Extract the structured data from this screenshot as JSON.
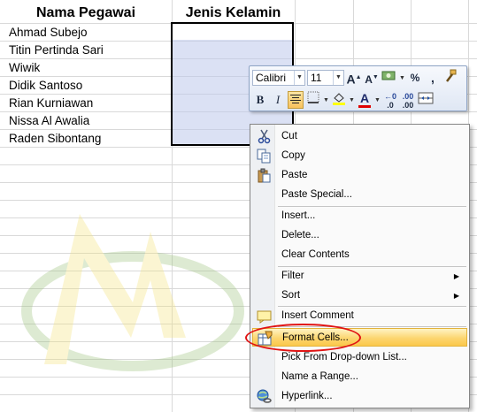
{
  "sheet": {
    "headers": {
      "col_a": "Nama Pegawai",
      "col_b": "Jenis Kelamin"
    },
    "names": [
      "Ahmad Subejo",
      "Titin Pertinda Sari",
      "Wiwik",
      "Didik Santoso",
      "Rian Kurniawan",
      "Nissa Al Awalia",
      "Raden Sibontang"
    ]
  },
  "mini_toolbar": {
    "font_name": "Calibri",
    "font_size": "11",
    "grow_font": "A",
    "shrink_font": "A",
    "percent": "%",
    "comma": ",",
    "bold": "B",
    "italic": "I",
    "font_color_letter": "A",
    "inc_decimal": ".0",
    "dec_decimal": ".00"
  },
  "context_menu": {
    "items": [
      {
        "label": "Cut",
        "icon": "scissors-icon"
      },
      {
        "label": "Copy",
        "icon": "copy-icon"
      },
      {
        "label": "Paste",
        "icon": "paste-icon"
      },
      {
        "label": "Paste Special...",
        "icon": ""
      },
      {
        "label": "Insert...",
        "icon": ""
      },
      {
        "label": "Delete...",
        "icon": ""
      },
      {
        "label": "Clear Contents",
        "icon": ""
      },
      {
        "label": "Filter",
        "icon": "",
        "submenu": true
      },
      {
        "label": "Sort",
        "icon": "",
        "submenu": true
      },
      {
        "label": "Insert Comment",
        "icon": "comment-icon"
      },
      {
        "label": "Format Cells...",
        "icon": "format-cells-icon",
        "highlighted": true
      },
      {
        "label": "Pick From Drop-down List...",
        "icon": ""
      },
      {
        "label": "Name a Range...",
        "icon": ""
      },
      {
        "label": "Hyperlink...",
        "icon": "hyperlink-icon"
      }
    ]
  },
  "colors": {
    "selection_fill": "#c7cbe9",
    "highlight": "#fcd670",
    "annotation_oval": "#e01414",
    "font_color_bar": "#e00000",
    "fill_color_bar": "#ffff00"
  }
}
